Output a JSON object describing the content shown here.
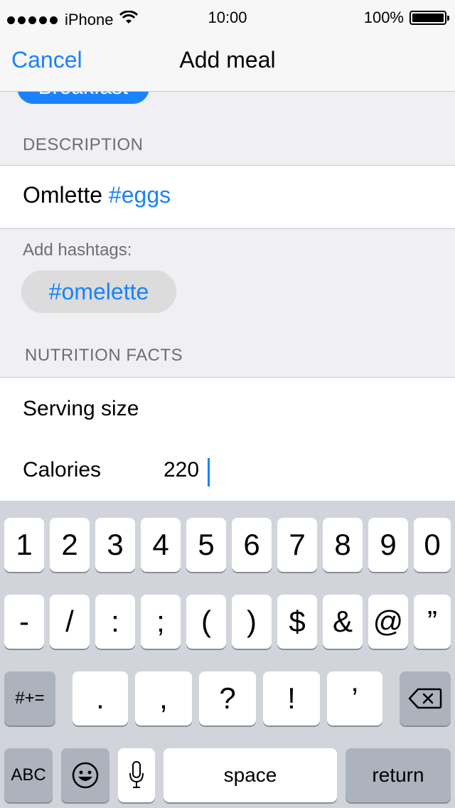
{
  "status_bar": {
    "carrier": "iPhone",
    "time": "10:00",
    "battery": "100%"
  },
  "nav": {
    "cancel_label": "Cancel",
    "title": "Add meal"
  },
  "meal_type_chip": "Breakfast",
  "description": {
    "section_label": "DESCRIPTION",
    "text": "Omlette",
    "hashtag": "#eggs"
  },
  "hashtags": {
    "label": "Add hashtags:",
    "suggestion": "#omelette"
  },
  "nutrition": {
    "section_label": "NUTRITION FACTS",
    "serving_label": "Serving size",
    "calories_label": "Calories",
    "calories_value": "220"
  },
  "keyboard": {
    "row1": [
      "1",
      "2",
      "3",
      "4",
      "5",
      "6",
      "7",
      "8",
      "9",
      "0"
    ],
    "row2": [
      "-",
      "/",
      ":",
      ";",
      "(",
      ")",
      "$",
      "&",
      "@",
      "”"
    ],
    "row3": [
      ".",
      ",",
      "?",
      "!",
      "’"
    ],
    "symbols_key": "#+=",
    "abc_key": "ABC",
    "space_key": "space",
    "return_key": "return"
  },
  "icons": {
    "wifi": "wifi-icon",
    "battery": "battery-icon",
    "backspace": "backspace-icon",
    "emoji": "emoji-icon",
    "mic": "microphone-icon"
  }
}
